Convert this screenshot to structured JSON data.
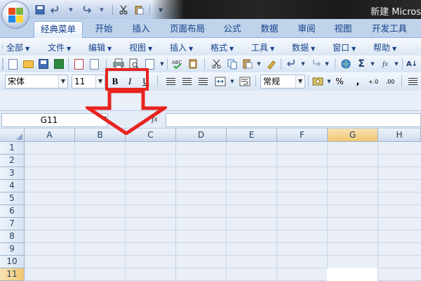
{
  "window": {
    "title": "新建 Micros"
  },
  "quick_access": {
    "icons": [
      "save-icon",
      "undo-icon",
      "redo-icon",
      "scissors-icon",
      "paste-icon",
      "customize-icon"
    ]
  },
  "ribbon_tabs": [
    {
      "label": "经典菜单",
      "active": true
    },
    {
      "label": "开始"
    },
    {
      "label": "插入"
    },
    {
      "label": "页面布局"
    },
    {
      "label": "公式"
    },
    {
      "label": "数据"
    },
    {
      "label": "审阅"
    },
    {
      "label": "视图"
    },
    {
      "label": "开发工具"
    }
  ],
  "menus": [
    {
      "label": "全部"
    },
    {
      "label": "文件"
    },
    {
      "label": "编辑"
    },
    {
      "label": "视图"
    },
    {
      "label": "插入"
    },
    {
      "label": "格式"
    },
    {
      "label": "工具"
    },
    {
      "label": "数据"
    },
    {
      "label": "窗口"
    },
    {
      "label": "帮助"
    }
  ],
  "toolbar": {
    "font_name": "宋体",
    "font_size": "11",
    "bold_label": "B",
    "italic_label": "I",
    "underline_label": "U",
    "number_format": "常规",
    "percent_label": "%",
    "comma_label": ",",
    "sum_label": "Σ",
    "fx_label": "fx",
    "sort_label": "A↓",
    "increase_decimal_label": "+.0",
    "decrease_decimal_label": ".00"
  },
  "formula_bar": {
    "name_box": "G11",
    "fx_label": "fx",
    "formula": ""
  },
  "sheet": {
    "columns": [
      "A",
      "B",
      "C",
      "D",
      "E",
      "F",
      "G",
      "H"
    ],
    "rows": [
      "1",
      "2",
      "3",
      "4",
      "5",
      "6",
      "7",
      "8",
      "9",
      "10",
      "11"
    ],
    "selected_cell": "G11"
  },
  "annotation": {
    "highlight_color": "#e8241f"
  }
}
